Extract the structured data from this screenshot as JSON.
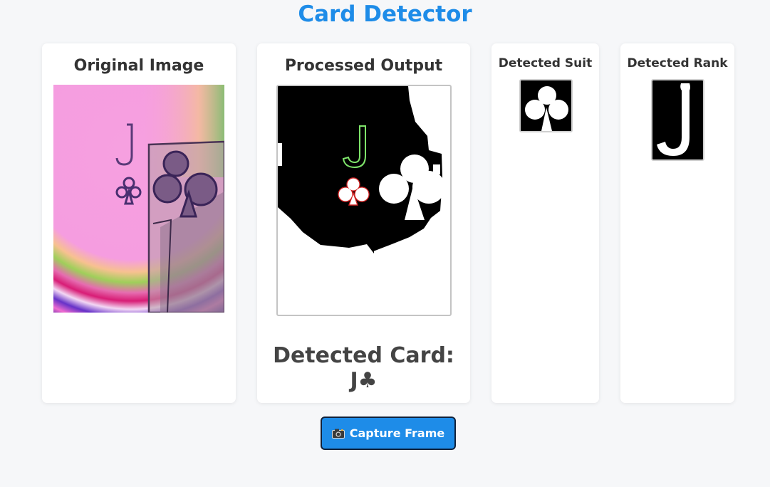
{
  "page": {
    "title": "Card Detector"
  },
  "panels": {
    "original": {
      "title": "Original Image"
    },
    "processed": {
      "title": "Processed Output",
      "detected_card": "Detected Card: J♣"
    },
    "suit": {
      "title": "Detected Suit"
    },
    "rank": {
      "title": "Detected Rank",
      "glyph": "J"
    }
  },
  "capture_button": {
    "label": "Capture Frame",
    "icon": "camera-icon"
  },
  "colors": {
    "accent": "#1e8ce8",
    "background": "#f6f7f9",
    "text": "#333333",
    "button_border": "#10213a"
  }
}
